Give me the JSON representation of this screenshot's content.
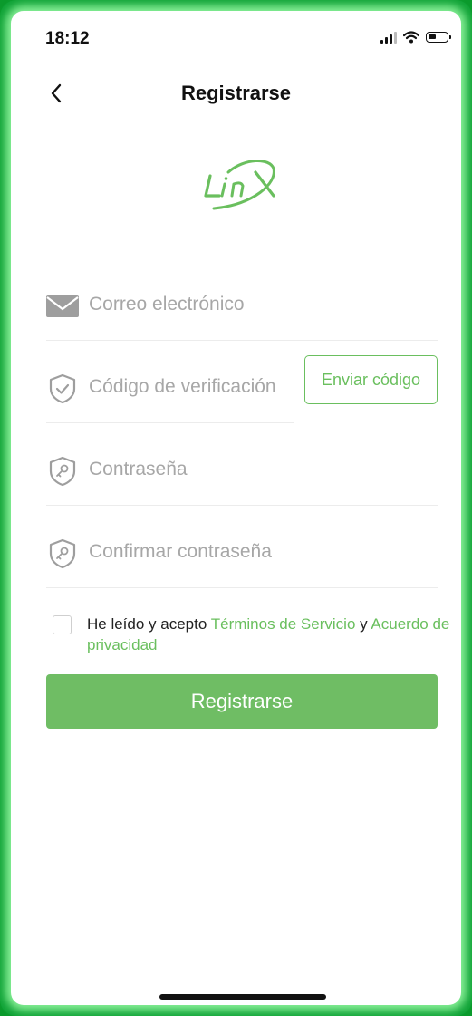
{
  "status_bar": {
    "time": "18:12"
  },
  "header": {
    "title": "Registrarse",
    "back_icon": "chevron-left-icon"
  },
  "logo": {
    "text": "Linx",
    "color": "#6abf5e"
  },
  "form": {
    "email": {
      "placeholder": "Correo electrónico",
      "icon": "mail-icon"
    },
    "code": {
      "placeholder": "Código de verificación",
      "icon": "shield-check-icon",
      "send_label": "Enviar código"
    },
    "password": {
      "placeholder": "Contraseña",
      "icon": "shield-key-icon"
    },
    "confirm_password": {
      "placeholder": "Confirmar contraseña",
      "icon": "shield-key-icon"
    }
  },
  "terms": {
    "prefix": "He leído y acepto ",
    "terms_link": "Términos de Servicio",
    "conjunction": " y ",
    "privacy_link": "Acuerdo de privacidad",
    "checked": false
  },
  "submit": {
    "label": "Registrarse"
  },
  "colors": {
    "accent": "#6abf5e",
    "button": "#6fbd64",
    "placeholder": "#a7a7a7",
    "frame": "#0fa236"
  }
}
